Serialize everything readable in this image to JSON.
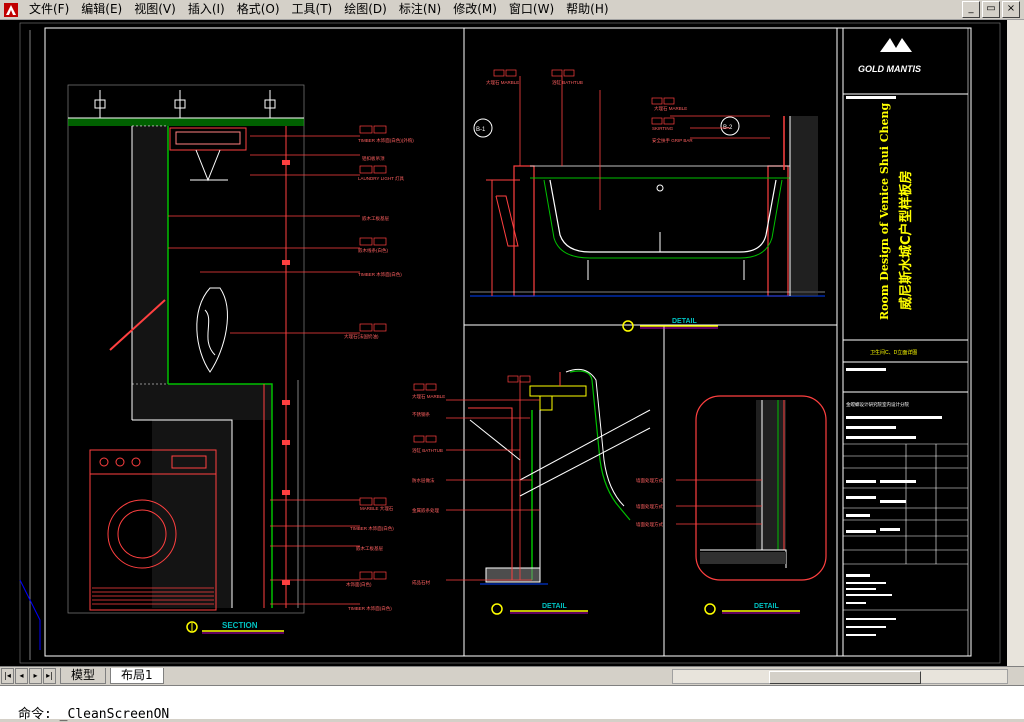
{
  "menubar": {
    "items": [
      "文件(F)",
      "编辑(E)",
      "视图(V)",
      "插入(I)",
      "格式(O)",
      "工具(T)",
      "绘图(D)",
      "标注(N)",
      "修改(M)",
      "窗口(W)",
      "帮助(H)"
    ]
  },
  "window_controls": {
    "minimize": "_",
    "restore": "▭",
    "close": "×"
  },
  "drawing": {
    "logo_text": "GOLD MANTIS",
    "title_en": "Room Design of Venice Shui Cheng",
    "title_cn": "威尼斯水城C户型样板房",
    "section_label": "SECTION",
    "detail_label_1": "DETAIL",
    "detail_label_2": "DETAIL",
    "detail_label_3": "DETAIL",
    "section_tags": [
      "TIMBER 木饰面(白色)(外购)",
      "铝扣板吊顶",
      "LAUNDRY LIGHT 灯具",
      "嵌木工板基层",
      "嵌木线条(白色)",
      "TIMBER 木饰面(白色)",
      "大理石(法国奶油)",
      "MARBLE 大理石",
      "TIMBER 木饰面(白色)",
      "嵌木工板基层",
      "木饰面(白色)",
      "TIMBER 木饰面(白色)"
    ],
    "tub_tags": [
      "大理石 MARBLE",
      "浴缸 BATHTUB",
      "大理石 MARBLE",
      "SKIRTING",
      "安全扶手 GRIP BAR"
    ],
    "callouts": [
      "B-1",
      "B-2"
    ],
    "detail_tags": [
      "大理石 MARBLE",
      "不锈钢条",
      "浴缸 BATHTUB",
      "防水层做法",
      "金属嵌条处理",
      "成品石材"
    ],
    "detail3_tags": [
      "墙面处理方式",
      "墙面处理方式",
      "墙面处理方式"
    ],
    "title_block_project": "金螳螂设计研究院室内设计分院",
    "title_block_sheet": "卫生间C、D立面详图"
  },
  "tabs": {
    "model": "模型",
    "layout1": "布局1"
  },
  "command": {
    "prompt": "命令:",
    "value": "_CleanScreenON"
  }
}
